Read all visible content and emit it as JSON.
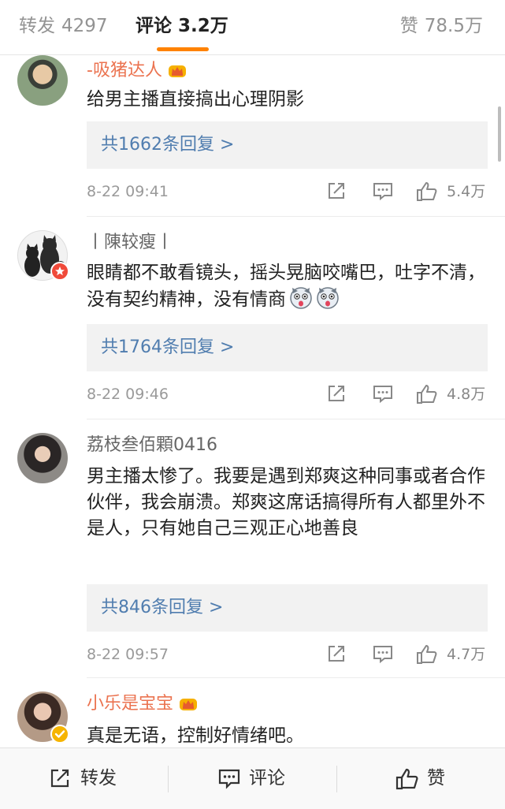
{
  "tabs": {
    "repost_label": "转发",
    "repost_count": "4297",
    "comment_label": "评论",
    "comment_count": "3.2万",
    "like_label": "赞",
    "like_count": "78.5万",
    "active_color": "#ff8200"
  },
  "comments": [
    {
      "username": "-吸猪达人",
      "content": "给男主播直接搞出心理阴影",
      "replies": "共1662条回复 >",
      "time": "8-22 09:41",
      "likes": "5.4万"
    },
    {
      "username": "丨陳较瘦丨",
      "content": "眼睛都不敢看镜头，摇头晃脑咬嘴巴，吐字不清，没有契约精神，没有情商",
      "replies": "共1764条回复 >",
      "time": "8-22 09:46",
      "likes": "4.8万"
    },
    {
      "username": "荔枝叁佰顆0416",
      "content": "男主播太惨了。我要是遇到郑爽这种同事或者合作伙伴，我会崩溃。郑爽这席话搞得所有人都里外不是人，只有她自己三观正心地善良",
      "replies": "共846条回复 >",
      "time": "8-22 09:57",
      "likes": "4.7万"
    },
    {
      "username": "小乐是宝宝",
      "content": "真是无语，控制好情绪吧。"
    }
  ],
  "bottom_bar": {
    "repost": "转发",
    "comment": "评论",
    "like": "赞"
  },
  "colors": {
    "username_vip": "#eb7350",
    "link": "#507daf"
  },
  "icons": [
    "crown-icon",
    "share-icon",
    "comment-icon",
    "like-icon",
    "dog-emoji-icon",
    "verified-badge-icon"
  ]
}
